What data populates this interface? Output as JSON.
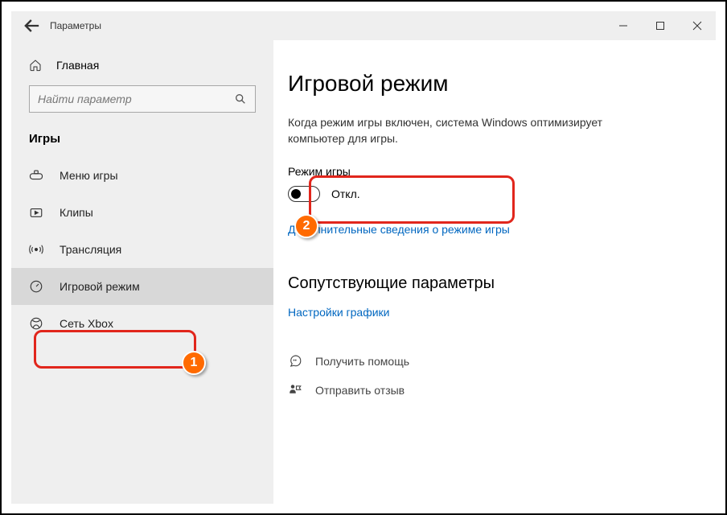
{
  "window": {
    "title": "Параметры"
  },
  "sidebar": {
    "home": "Главная",
    "search_placeholder": "Найти параметр",
    "section": "Игры",
    "items": [
      {
        "label": "Меню игры"
      },
      {
        "label": "Клипы"
      },
      {
        "label": "Трансляция"
      },
      {
        "label": "Игровой режим"
      },
      {
        "label": "Сеть Xbox"
      }
    ]
  },
  "main": {
    "title": "Игровой режим",
    "description": "Когда режим игры включен, система Windows оптимизирует компьютер для игры.",
    "toggle_label": "Режим игры",
    "toggle_state": "Откл.",
    "learn_more": "Дополнительные сведения о режиме игры",
    "related_header": "Сопутствующие параметры",
    "graphics_link": "Настройки графики",
    "get_help": "Получить помощь",
    "feedback": "Отправить отзыв"
  },
  "annotations": {
    "badge1": "1",
    "badge2": "2"
  }
}
